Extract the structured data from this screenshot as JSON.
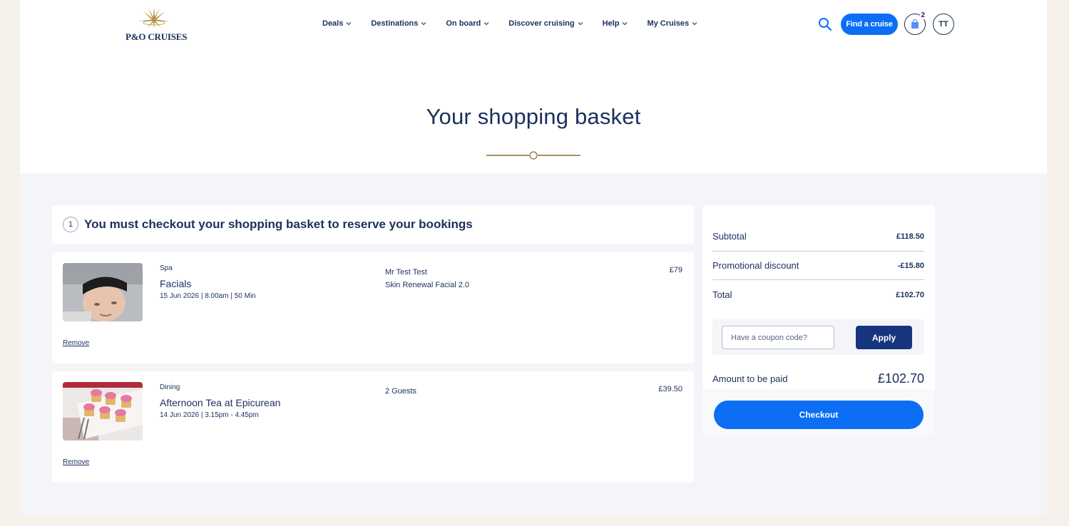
{
  "brand": {
    "logo_text": "P&O CRUISES"
  },
  "nav": {
    "items": [
      {
        "label": "Deals"
      },
      {
        "label": "Destinations"
      },
      {
        "label": "On board"
      },
      {
        "label": "Discover cruising"
      },
      {
        "label": "Help"
      },
      {
        "label": "My Cruises"
      }
    ]
  },
  "header": {
    "find_label": "Find a cruise",
    "basket_count": "2",
    "avatar_initials": "TT"
  },
  "page": {
    "title": "Your shopping basket"
  },
  "notice": {
    "number": "1",
    "text": "You must checkout your shopping basket to reserve your bookings"
  },
  "items": [
    {
      "category": "Spa",
      "name": "Facials",
      "date": "15 Jun 2026 | 8.00am | 50 Min",
      "guest": "Mr Test Test",
      "detail": "Skin Renewal Facial 2.0",
      "price": "£79",
      "remove_label": "Remove"
    },
    {
      "category": "Dining",
      "name": "Afternoon Tea at Epicurean",
      "date": "14 Jun 2026 | 3.15pm - 4.45pm",
      "guest": "2 Guests",
      "detail": "",
      "price": "£39.50",
      "remove_label": "Remove"
    }
  ],
  "summary": {
    "subtotal_label": "Subtotal",
    "subtotal_value": "£118.50",
    "discount_label": "Promotional discount",
    "discount_value": "-£15.80",
    "total_label": "Total",
    "total_value": "£102.70",
    "coupon_placeholder": "Have a coupon code?",
    "apply_label": "Apply",
    "amount_label": "Amount to be paid",
    "amount_value": "£102.70",
    "checkout_label": "Checkout"
  },
  "colors": {
    "navy": "#1c2f5e",
    "accent_blue": "#0b6ef5",
    "gold": "#8a6d2c",
    "band": "#f4f5f9"
  }
}
